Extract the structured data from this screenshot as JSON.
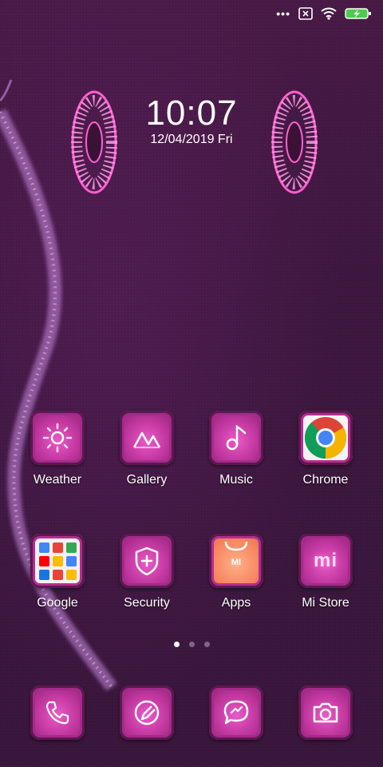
{
  "status_bar": {
    "more": "•••",
    "icons": [
      "screenshot-x-icon",
      "wifi-icon",
      "battery-charging-icon"
    ]
  },
  "clock": {
    "time": "10:07",
    "date": "12/04/2019 Fri"
  },
  "home": {
    "row1": [
      {
        "label": "Weather",
        "icon": "sun-icon"
      },
      {
        "label": "Gallery",
        "icon": "mountains-icon"
      },
      {
        "label": "Music",
        "icon": "music-note-icon"
      },
      {
        "label": "Chrome",
        "icon": "chrome-icon"
      }
    ],
    "row2": [
      {
        "label": "Google",
        "icon": "google-folder-icon"
      },
      {
        "label": "Security",
        "icon": "shield-plus-icon"
      },
      {
        "label": "Apps",
        "icon": "mi-bag-icon",
        "tile_text": "MI"
      },
      {
        "label": "Mi Store",
        "icon": "mi-logo-icon",
        "tile_text": "mi"
      }
    ]
  },
  "pager": {
    "pages": 3,
    "active": 0
  },
  "dock": [
    {
      "icon": "phone-icon"
    },
    {
      "icon": "browser-icon"
    },
    {
      "icon": "message-icon"
    },
    {
      "icon": "camera-icon"
    }
  ],
  "colors": {
    "neon_pink": "#ff5fd0",
    "background": "#3e1840",
    "tile": "#c63aa3"
  }
}
